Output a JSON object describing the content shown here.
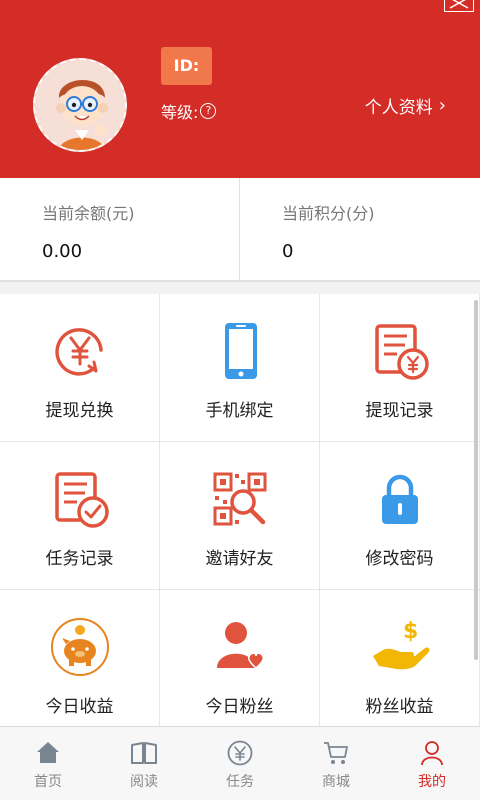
{
  "header": {
    "id_label": "ID:",
    "level_label": "等级:",
    "help_glyph": "?",
    "profile_link": "个人资料",
    "chevron": "›",
    "background_color": "#d42c27"
  },
  "stats": {
    "balance_label": "当前余额(元)",
    "balance_value": "0.00",
    "points_label": "当前积分(分)",
    "points_value": "0"
  },
  "grid": [
    {
      "label": "提现兑换",
      "icon": "withdraw-exchange-icon"
    },
    {
      "label": "手机绑定",
      "icon": "phone-icon"
    },
    {
      "label": "提现记录",
      "icon": "withdraw-record-icon"
    },
    {
      "label": "任务记录",
      "icon": "task-record-icon"
    },
    {
      "label": "邀请好友",
      "icon": "qr-invite-icon"
    },
    {
      "label": "修改密码",
      "icon": "lock-icon"
    },
    {
      "label": "今日收益",
      "icon": "piggy-bank-icon"
    },
    {
      "label": "今日粉丝",
      "icon": "fans-icon"
    },
    {
      "label": "粉丝收益",
      "icon": "money-hand-icon"
    }
  ],
  "tabbar": [
    {
      "label": "首页",
      "icon": "home-icon",
      "active": false
    },
    {
      "label": "阅读",
      "icon": "book-icon",
      "active": false
    },
    {
      "label": "任务",
      "icon": "yuan-icon",
      "active": false
    },
    {
      "label": "商城",
      "icon": "cart-icon",
      "active": false
    },
    {
      "label": "我的",
      "icon": "person-icon",
      "active": true
    }
  ],
  "colors": {
    "accent": "#d42c27",
    "icon_red": "#e0533d",
    "icon_blue": "#3a9ae8",
    "icon_gold": "#f2b705"
  }
}
